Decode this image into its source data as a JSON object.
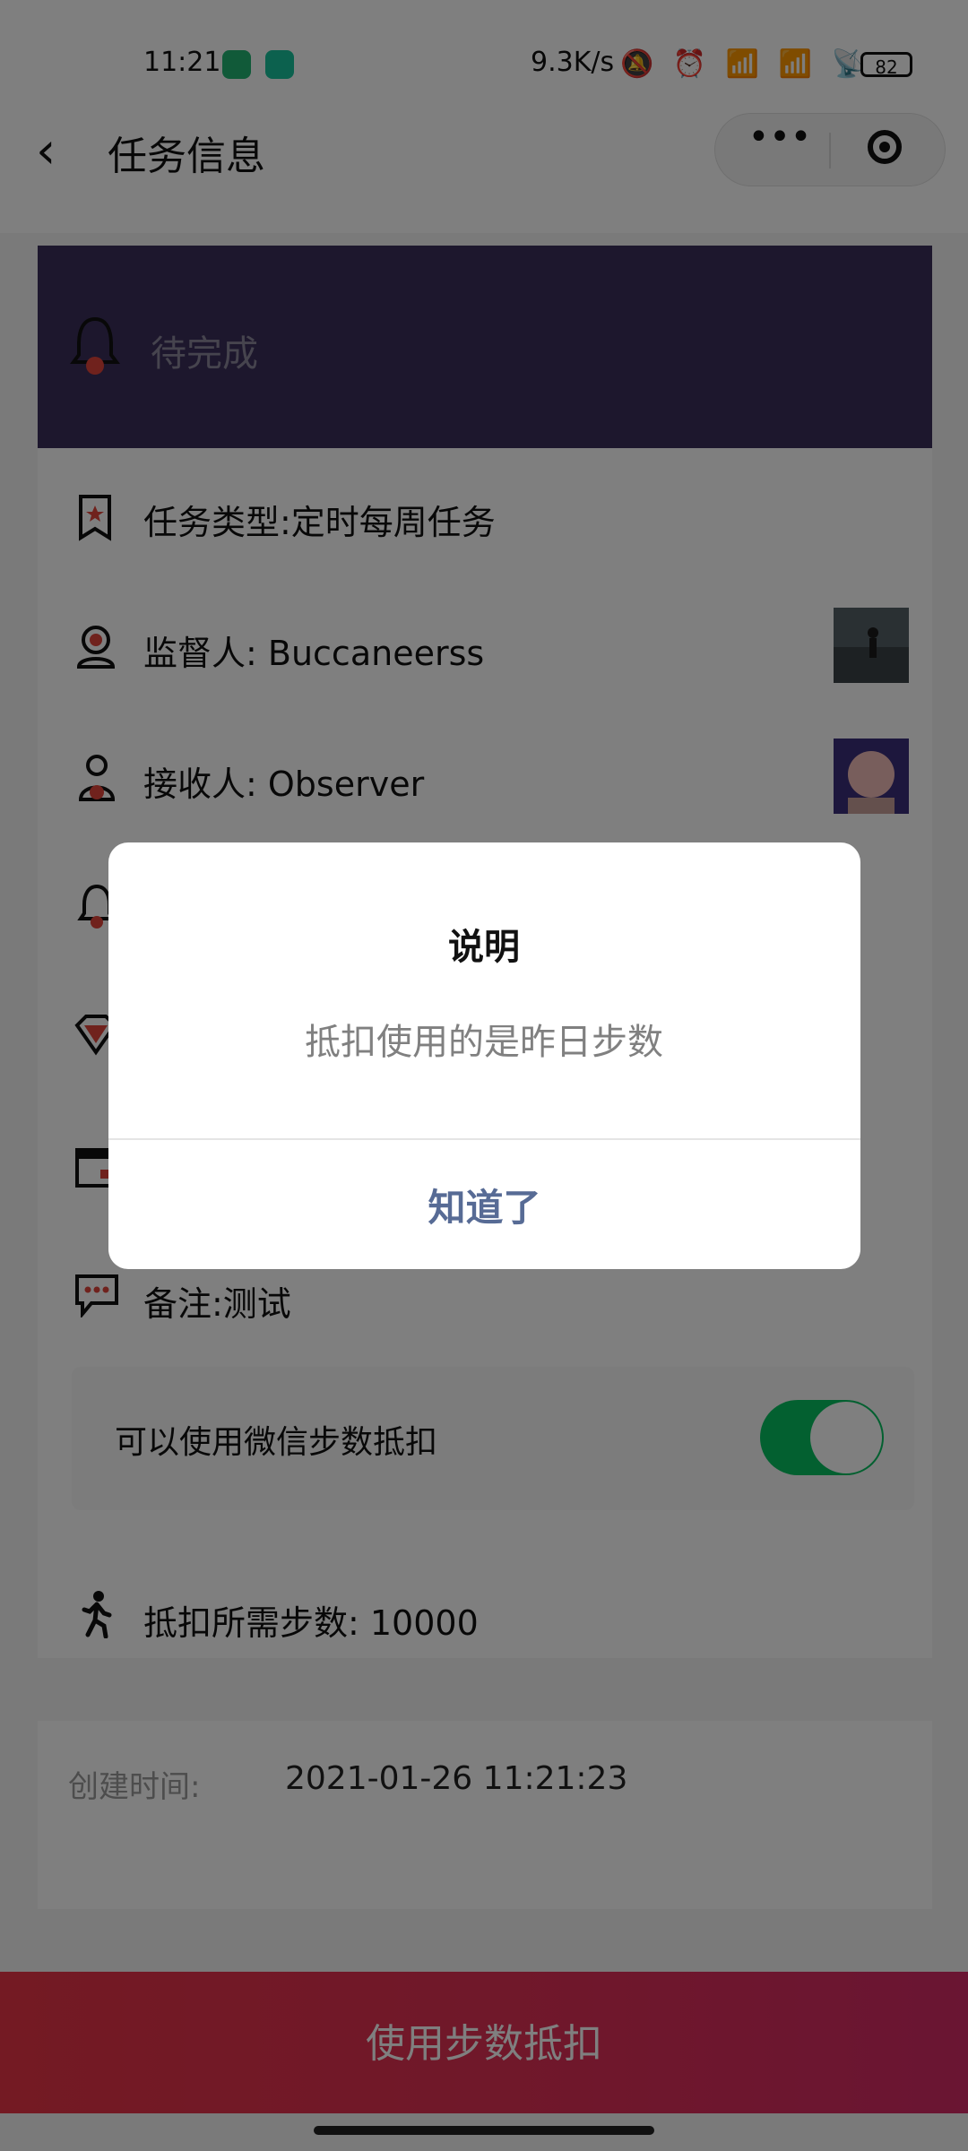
{
  "status_bar": {
    "time": "11:21",
    "network_speed": "9.3K/s",
    "icons": "🔕 ⏰ 📶 📶 📡",
    "battery": "82"
  },
  "nav": {
    "title": "任务信息",
    "more_icon": "•••"
  },
  "task": {
    "status": "待完成",
    "rows": [
      {
        "text": "任务类型:定时每周任务"
      },
      {
        "text": "监督人: Buccaneerss"
      },
      {
        "text": "接收人: Observer"
      },
      {
        "text": "备注:测试"
      }
    ],
    "switch_label": "可以使用微信步数抵扣",
    "switch_on": true,
    "steps_text": "抵扣所需步数: 10000"
  },
  "created": {
    "label": "创建时间:",
    "value": "2021-01-26 11:21:23"
  },
  "bottom_button": "使用步数抵扣",
  "dialog": {
    "title": "说明",
    "message": "抵扣使用的是昨日步数",
    "confirm": "知道了"
  },
  "colors": {
    "header": "#3a2f5a",
    "accent": "#e83446",
    "switch": "#07c160",
    "dialog_button": "#576b95"
  }
}
